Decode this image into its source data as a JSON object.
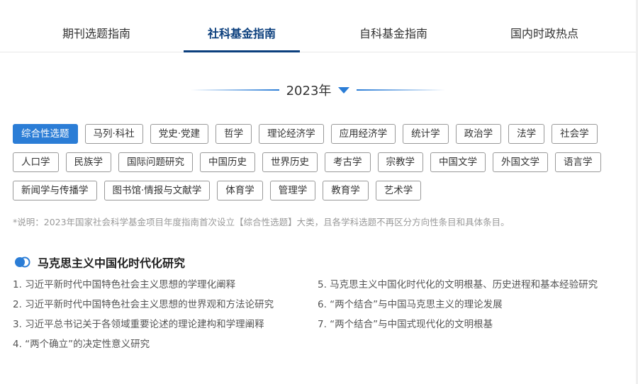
{
  "tabs": [
    {
      "label": "期刊选题指南"
    },
    {
      "label": "社科基金指南",
      "active": true
    },
    {
      "label": "自科基金指南"
    },
    {
      "label": "国内时政热点"
    }
  ],
  "year": {
    "label": "2023年",
    "icon": "caret-down-icon"
  },
  "accent": "#2b7dd6",
  "tags": [
    "综合性选题",
    "马列·科社",
    "党史·党建",
    "哲学",
    "理论经济学",
    "应用经济学",
    "统计学",
    "政治学",
    "法学",
    "社会学",
    "人口学",
    "民族学",
    "国际问题研究",
    "中国历史",
    "世界历史",
    "考古学",
    "宗教学",
    "中国文学",
    "外国文学",
    "语言学",
    "新闻学与传播学",
    "图书馆·情报与文献学",
    "体育学",
    "管理学",
    "教育学",
    "艺术学"
  ],
  "active_tag": "综合性选题",
  "note": "*说明：2023年国家社会科学基金项目年度指南首次设立【综合性选题】大类，且各学科选题不再区分方向性条目和具体条目。",
  "section": {
    "title": "马克思主义中国化时代化研究",
    "left": [
      "1. 习近平新时代中国特色社会主义思想的学理化阐释",
      "2. 习近平新时代中国特色社会主义思想的世界观和方法论研究",
      "3. 习近平总书记关于各领域重要论述的理论建构和学理阐释",
      "4. “两个确立”的决定性意义研究"
    ],
    "right": [
      "5. 马克思主义中国化时代化的文明根基、历史进程和基本经验研究",
      "6. “两个结合”与中国马克思主义的理论发展",
      "7. “两个结合”与中国式现代化的文明根基"
    ]
  }
}
